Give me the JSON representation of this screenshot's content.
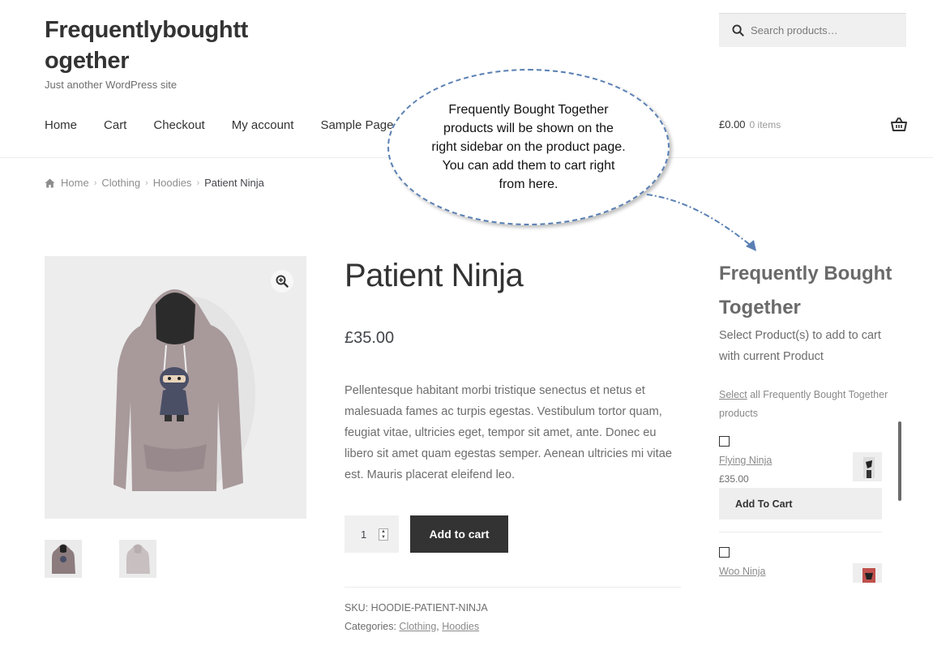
{
  "site": {
    "title": "Frequentlyboughttogether",
    "tagline": "Just another WordPress site"
  },
  "search": {
    "placeholder": "Search products…"
  },
  "nav": {
    "items": [
      "Home",
      "Cart",
      "Checkout",
      "My account",
      "Sample Page"
    ]
  },
  "cart": {
    "total": "£0.00",
    "count": "0 items"
  },
  "breadcrumb": {
    "items": [
      "Home",
      "Clothing",
      "Hoodies"
    ],
    "current": "Patient Ninja"
  },
  "product": {
    "title": "Patient Ninja",
    "price": "£35.00",
    "description": "Pellentesque habitant morbi tristique senectus et netus et malesuada fames ac turpis egestas. Vestibulum tortor quam, feugiat vitae, ultricies eget, tempor sit amet, ante. Donec eu libero sit amet quam egestas semper. Aenean ultricies mi vitae est. Mauris placerat eleifend leo.",
    "quantity": "1",
    "add_to_cart": "Add to cart",
    "sku_label": "SKU:",
    "sku": "HOODIE-PATIENT-NINJA",
    "categories_label": "Categories:",
    "categories": [
      "Clothing",
      "Hoodies"
    ]
  },
  "callout": {
    "text": "Frequently Bought Together products will be shown on the right sidebar on the product page. You can add them to cart right from here."
  },
  "fbt": {
    "title": "Frequently Bought Together",
    "subtitle": "Select Product(s) to add to cart with current Product",
    "select_link": "Select",
    "select_rest": " all Frequently Bought Together products",
    "items": [
      {
        "name": "Flying Ninja",
        "price": "£35.00",
        "button": "Add To Cart"
      },
      {
        "name": "Woo Ninja"
      }
    ]
  },
  "colors": {
    "accent_dark": "#333333",
    "callout_border": "#5a80b3",
    "hoodie": "#a8999b"
  }
}
